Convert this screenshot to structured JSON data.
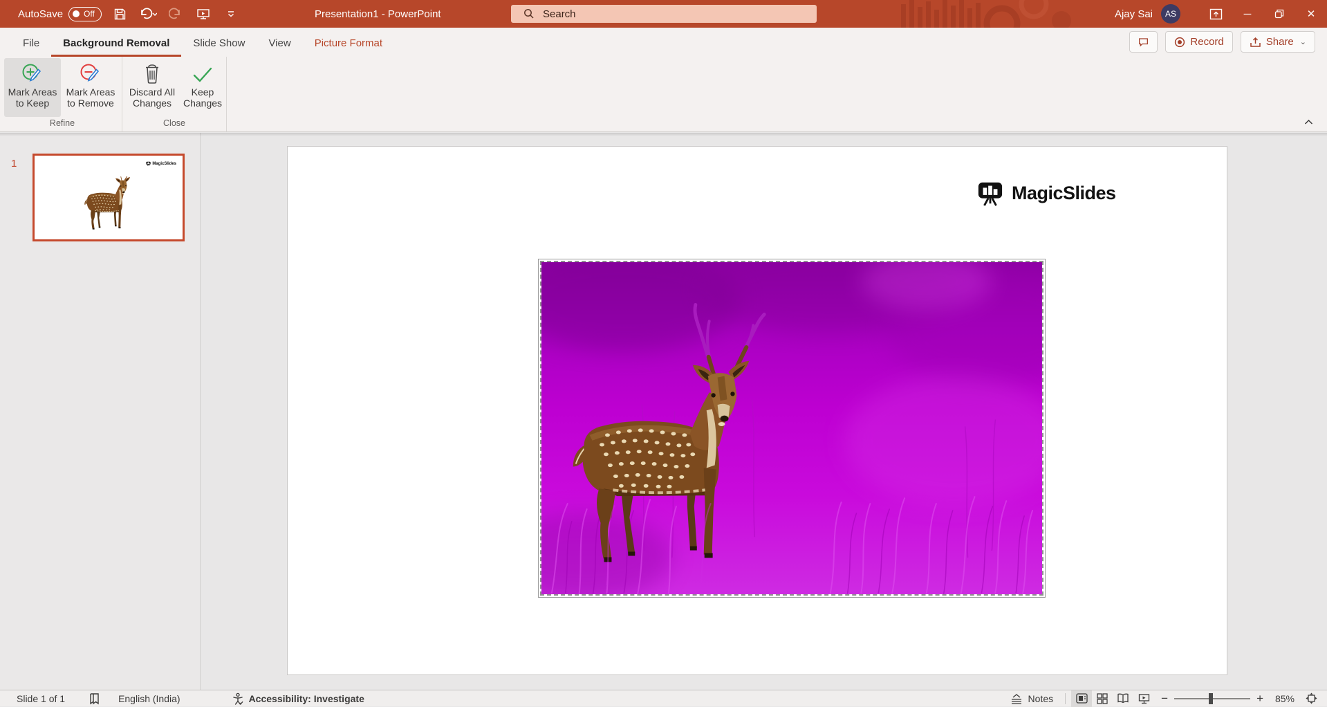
{
  "titlebar": {
    "autosave_label": "AutoSave",
    "autosave_state": "Off",
    "title": "Presentation1 - PowerPoint",
    "search_placeholder": "Search",
    "user_name": "Ajay Sai",
    "user_initials": "AS"
  },
  "tabs": {
    "items": [
      {
        "label": "File"
      },
      {
        "label": "Background Removal"
      },
      {
        "label": "Slide Show"
      },
      {
        "label": "View"
      },
      {
        "label": "Picture Format"
      }
    ]
  },
  "topbar": {
    "record_label": "Record",
    "share_label": "Share"
  },
  "ribbon": {
    "buttons": [
      {
        "line1": "Mark Areas",
        "line2": "to Keep",
        "icon": "mark-areas-keep-icon"
      },
      {
        "line1": "Mark Areas",
        "line2": "to Remove",
        "icon": "mark-areas-remove-icon"
      },
      {
        "line1": "Discard All",
        "line2": "Changes",
        "icon": "trash-icon"
      },
      {
        "line1": "Keep",
        "line2": "Changes",
        "icon": "checkmark-icon"
      }
    ],
    "groups": [
      "Refine",
      "Close"
    ]
  },
  "thumbnails": {
    "slide_number": "1"
  },
  "slide": {
    "logo_text": "MagicSlides"
  },
  "statusbar": {
    "slide_indicator": "Slide 1 of 1",
    "language": "English (India)",
    "accessibility": "Accessibility: Investigate",
    "notes_label": "Notes",
    "zoom_percent": "85%"
  },
  "glyphs": {
    "minimize": "─",
    "close": "✕",
    "chevron_down": "⌄",
    "zoom_out": "−",
    "zoom_in": "+"
  },
  "colors": {
    "accent": "#B7472A",
    "search_fill": "#F4C6B4",
    "magenta_overlay": "#C400D4",
    "thumbnail_border": "#C5492C",
    "selected_button_bg": "#DFDDDC"
  }
}
